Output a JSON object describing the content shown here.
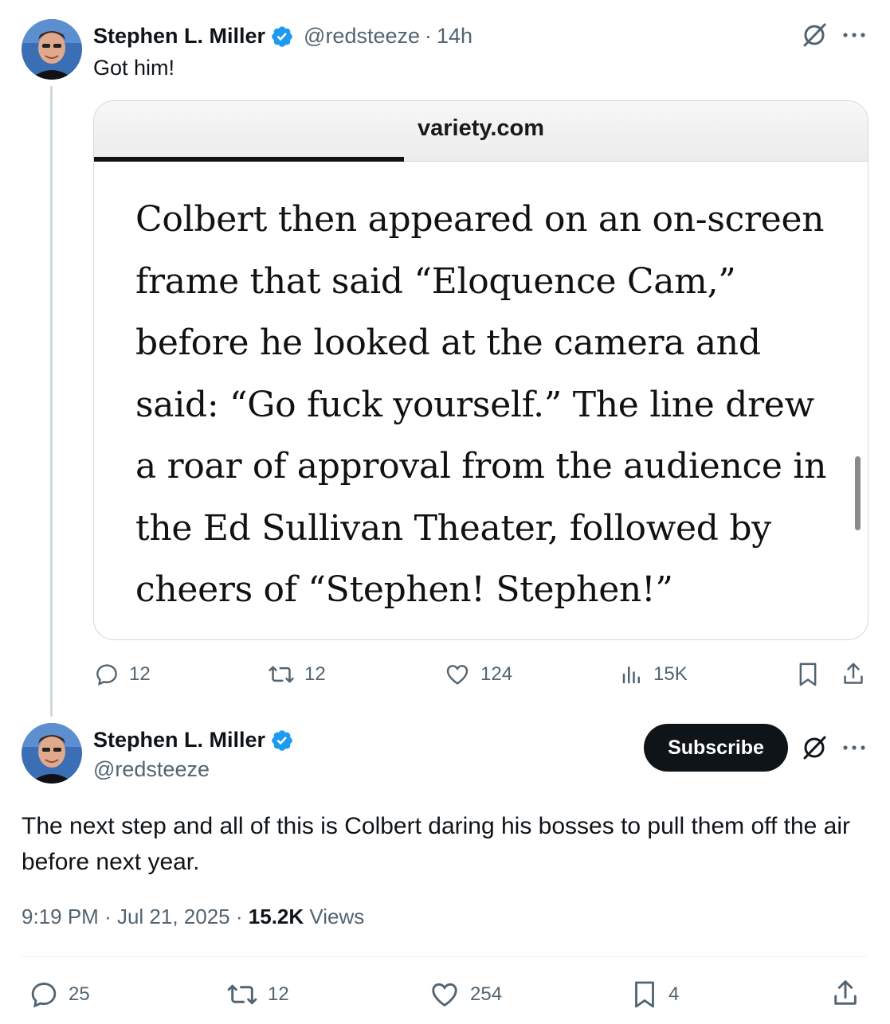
{
  "tweet1": {
    "author_name": "Stephen L. Miller",
    "handle": "@redsteeze",
    "separator": "·",
    "time": "14h",
    "text": "Got him!",
    "quote_card": {
      "domain": "variety.com",
      "body": "Colbert then appeared on an on-screen frame that said “Eloquence Cam,” before he looked at the camera and said: “Go fuck yourself.” The line drew a roar of approval from the audience in the Ed Sullivan Theater, followed by cheers of “Stephen! Stephen!”"
    },
    "actions": {
      "replies": "12",
      "reposts": "12",
      "likes": "124",
      "views": "15K"
    }
  },
  "tweet2": {
    "author_name": "Stephen L. Miller",
    "handle": "@redsteeze",
    "subscribe_label": "Subscribe",
    "text": "The next step and all of this is Colbert daring his bosses to pull them off the air before next year.",
    "time": "9:19 PM",
    "separator": "·",
    "date": "Jul 21, 2025",
    "separator2": "·",
    "views_count": "15.2K",
    "views_label": "Views",
    "actions": {
      "replies": "25",
      "reposts": "12",
      "likes": "254",
      "bookmarks": "4"
    }
  },
  "colors": {
    "verified": "#1d9bf0",
    "secondary_text": "#536471",
    "primary_text": "#0f1419",
    "button_bg": "#0f1419"
  },
  "icons": [
    "verified-badge-icon",
    "grok-icon",
    "more-icon",
    "reply-icon",
    "repost-icon",
    "like-icon",
    "views-icon",
    "bookmark-icon",
    "share-icon"
  ]
}
